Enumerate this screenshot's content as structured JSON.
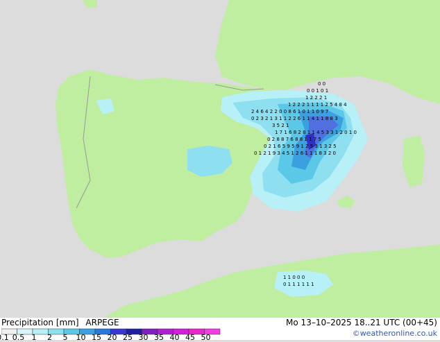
{
  "title": {
    "left_label": "Precipitation [mm]",
    "model": "ARPEGE",
    "valid_time": "Mo 13–10–2025 18..21 UTC (00+45)",
    "credit": "©weatheronline.co.uk"
  },
  "colors": {
    "sea": "#dcdcdc",
    "land": "#bfeea0",
    "border": "#999999",
    "p1": "#b8f0f8",
    "p2": "#8edff0",
    "p3": "#5cc8e8",
    "p4": "#3aa0e0",
    "p5": "#5070e0",
    "p6": "#3030c8"
  },
  "legend": {
    "labels": [
      "0.1",
      "0.5",
      "1",
      "2",
      "5",
      "10",
      "15",
      "20",
      "25",
      "30",
      "35",
      "40",
      "45",
      "50"
    ],
    "colors": [
      "#f0f0f0",
      "#d8f4f8",
      "#b8eef8",
      "#8edff0",
      "#5cc8e8",
      "#3aa0e0",
      "#2c78d8",
      "#3838d0",
      "#2020a0",
      "#8020c0",
      "#b020d0",
      "#d020d8",
      "#e828c8",
      "#f040e0"
    ]
  },
  "precip_labels": [
    {
      "text": "0 0",
      "row": 1
    },
    {
      "text": "0 0 1 0 1",
      "row": 2
    },
    {
      "text": "1 2 2 2 1",
      "row": 3
    },
    {
      "text": "1 2 2 2 1 1 1 1 2 5 4 8 4",
      "row": 4
    },
    {
      "text": "2 4 6 4 2 2 0 0 8 6 1 0 1 1 0 9 7",
      "row": 5
    },
    {
      "text": "0 2 3 2 1 3 1 1 2 2 6 1 1 4 1 1 8 8 3",
      "row": 6
    },
    {
      "text": "3 5 2 1",
      "row": 7
    },
    {
      "text": "1 7 1 6 8 2 8 1 1 4 5 3 3 1 2 0 1 0",
      "row": 8
    },
    {
      "text": "0 2 8 8 7 6 8 8 1 1 7 5",
      "row": 9
    },
    {
      "text": "0 2 1 6 5 9 5 9 1 2 5 3 1 3 2 5",
      "row": 10
    },
    {
      "text": "0 1 2 1 9 3 4 5 1 2 6 1 1 1 8 3 2 0",
      "row": 11
    },
    {
      "text": "1 1 0 0 0",
      "row": 12
    },
    {
      "text": "0 1 1 1 1 1 1",
      "row": 13
    }
  ]
}
